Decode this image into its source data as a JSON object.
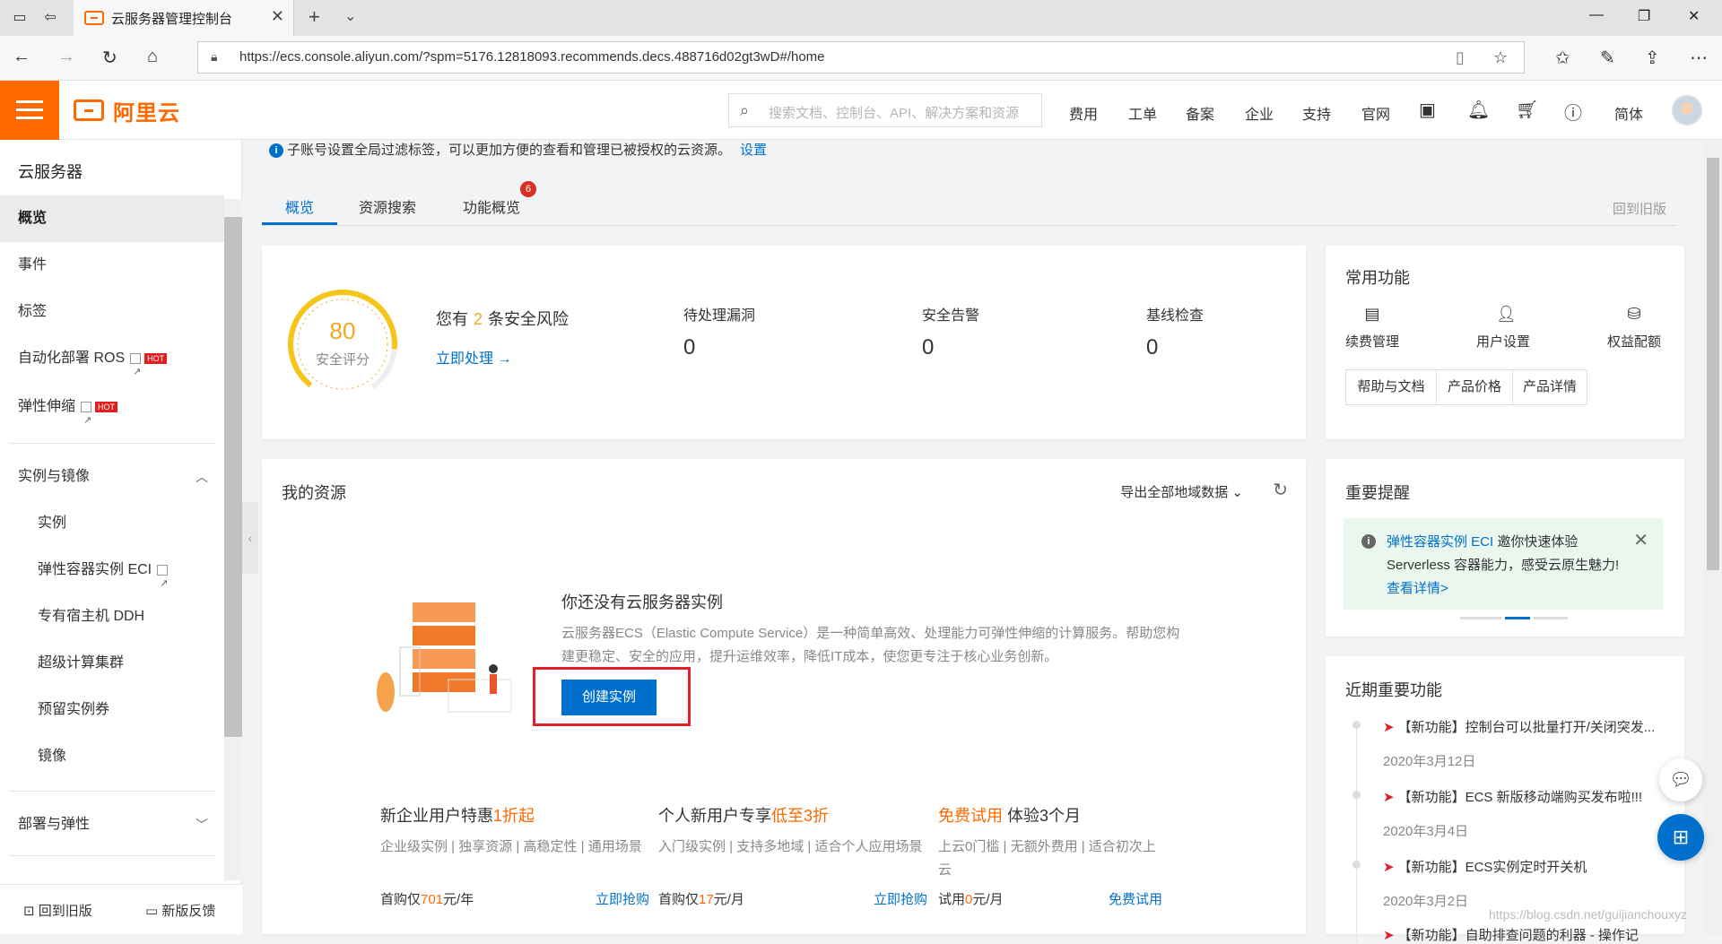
{
  "browser": {
    "tab_title": "云服务器管理控制台",
    "url": "https://ecs.console.aliyun.com/?spm=5176.12818093.recommends.decs.488716d02gt3wD#/home"
  },
  "header": {
    "logo_text": "阿里云",
    "search_placeholder": "搜索文档、控制台、API、解决方案和资源",
    "nav": [
      "费用",
      "工单",
      "备案",
      "企业",
      "支持",
      "官网"
    ],
    "lang": "简体"
  },
  "sidebar": {
    "title": "云服务器",
    "items": [
      {
        "label": "概览"
      },
      {
        "label": "事件"
      },
      {
        "label": "标签"
      },
      {
        "label": "自动化部署 ROS",
        "hot": "HOT"
      },
      {
        "label": "弹性伸缩",
        "hot": "HOT"
      }
    ],
    "group1": {
      "label": "实例与镜像"
    },
    "sub_items": [
      {
        "label": "实例"
      },
      {
        "label": "弹性容器实例 ECI"
      },
      {
        "label": "专有宿主机 DDH"
      },
      {
        "label": "超级计算集群"
      },
      {
        "label": "预留实例券"
      },
      {
        "label": "镜像"
      }
    ],
    "group2": {
      "label": "部署与弹性"
    },
    "footer": {
      "back": "回到旧版",
      "feedback": "新版反馈"
    }
  },
  "notice": {
    "text": "子账号设置全局过滤标签，可以更加方便的查看和管理已被授权的云资源。",
    "link": "设置"
  },
  "tabs": {
    "items": [
      {
        "label": "概览"
      },
      {
        "label": "资源搜索"
      },
      {
        "label": "功能概览"
      }
    ],
    "badge": "6",
    "back_old": "回到旧版"
  },
  "security": {
    "score": "80",
    "score_label": "安全评分",
    "risk_prefix": "您有",
    "risk_count": "2",
    "risk_suffix": "条安全风险",
    "action": "立即处理 →",
    "stats": [
      {
        "label": "待处理漏洞",
        "value": "0"
      },
      {
        "label": "安全告警",
        "value": "0"
      },
      {
        "label": "基线检查",
        "value": "0"
      }
    ]
  },
  "common": {
    "title": "常用功能",
    "icons": [
      {
        "label": "续费管理",
        "icon": "bill-icon"
      },
      {
        "label": "用户设置",
        "icon": "user-icon"
      },
      {
        "label": "权益配额",
        "icon": "database-icon"
      }
    ],
    "buttons": [
      "帮助与文档",
      "产品价格",
      "产品详情"
    ]
  },
  "resources": {
    "title": "我的资源",
    "export": "导出全部地域数据",
    "empty_title": "你还没有云服务器实例",
    "empty_desc": "云服务器ECS（Elastic Compute Service）是一种简单高效、处理能力可弹性伸缩的计算服务。帮助您构建更稳定、安全的应用，提升运维效率，降低IT成本，使您更专注于核心业务创新。",
    "create_button": "创建实例",
    "offers": [
      {
        "head": "新企业用户特惠",
        "highlight": "1折起",
        "desc": "企业级实例 | 独享资源 | 高稳定性 | 通用场景",
        "price_prefix": "首购仅",
        "price_value": "701",
        "price_unit": "元/年",
        "link": "立即抢购"
      },
      {
        "head": "个人新用户专享",
        "highlight": "低至3折",
        "desc": "入门级实例 | 支持多地域 | 适合个人应用场景",
        "price_prefix": "首购仅",
        "price_value": "17",
        "price_unit": "元/月",
        "link": "立即抢购"
      },
      {
        "head_highlight": "免费试用",
        "head": " 体验3个月",
        "desc": "上云0门槛 | 无额外费用 | 适合初次上云",
        "price_prefix": "试用",
        "price_value": "0",
        "price_unit": "元/月",
        "link": "免费试用"
      }
    ]
  },
  "reminder": {
    "title": "重要提醒",
    "link1": "弹性容器实例 ECI",
    "text": " 邀你快速体验Serverless 容器能力，感受云原生魅力! ",
    "link2": "查看详情>"
  },
  "recent": {
    "title": "近期重要功能",
    "items": [
      {
        "text": "【新功能】控制台可以批量打开/关闭突发...",
        "date": "2020年3月12日"
      },
      {
        "text": "【新功能】ECS 新版移动端购买发布啦!!!",
        "date": "2020年3月4日"
      },
      {
        "text": "【新功能】ECS实例定时开关机",
        "date": "2020年3月2日"
      },
      {
        "text": "【新功能】自助排查问题的利器 - 操作记",
        "date": ""
      }
    ]
  },
  "watermark": "https://blog.csdn.net/guijianchouxyz",
  "colors": {
    "brand": "#ff6a00",
    "link": "#0070cc",
    "highlight_box": "#e0202b"
  }
}
